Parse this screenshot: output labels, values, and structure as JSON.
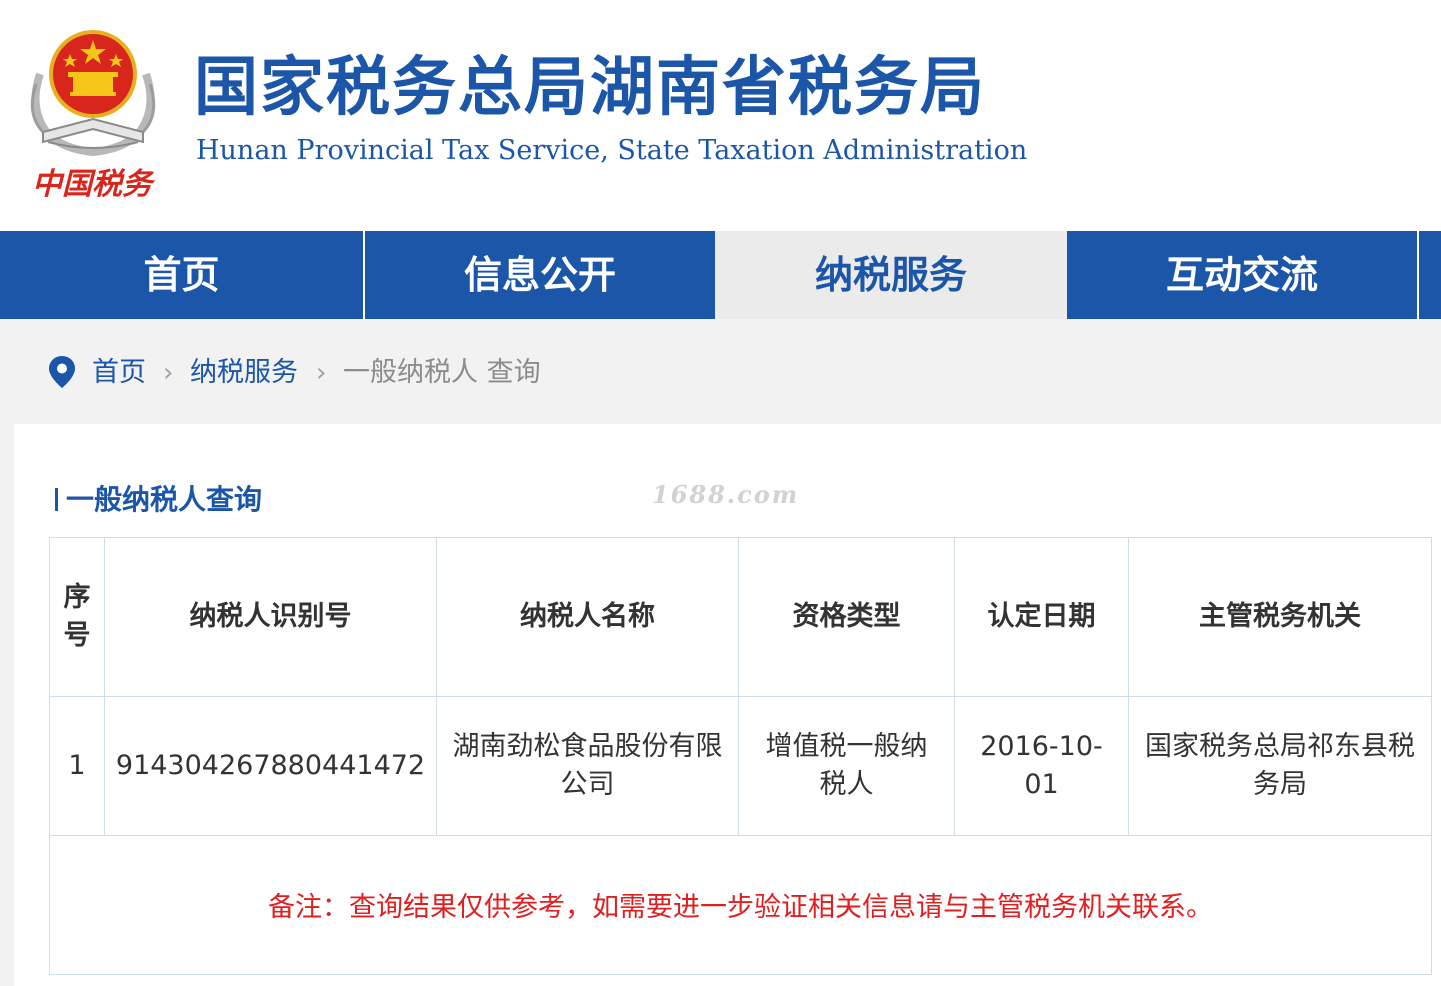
{
  "header": {
    "title_cn": "国家税务总局湖南省税务局",
    "title_en": "Hunan Provincial  Tax Service,  State Taxation Administration",
    "logo_text": "中国税务",
    "brand_color": "#1c56a8"
  },
  "nav": {
    "items": [
      {
        "label": "首页"
      },
      {
        "label": "信息公开"
      },
      {
        "label": "纳税服务"
      },
      {
        "label": "互动交流"
      }
    ],
    "active_index": 2
  },
  "breadcrumb": {
    "items": [
      "首页",
      "纳税服务",
      "一般纳税人 查询"
    ],
    "icon": "location-pin-icon"
  },
  "section": {
    "title": "一般纳税人查询"
  },
  "watermark": "1688.com",
  "table": {
    "headers": [
      "序号",
      "纳税人识别号",
      "纳税人名称",
      "资格类型",
      "认定日期",
      "主管税务机关"
    ],
    "rows": [
      [
        "1",
        "91430426788044147​2",
        "湖南劲松食品股份有限公司",
        "增值税一般纳税人",
        "2016-10-01",
        "国家税务总局祁东县税务局"
      ]
    ],
    "note": "备注：查询结果仅供参考，如需要进一步验证相关信息请与主管税务机关联系。"
  },
  "colors": {
    "accent": "#1c56a8",
    "note_red": "#e02020",
    "active_tab_bg": "#ebebeb"
  }
}
